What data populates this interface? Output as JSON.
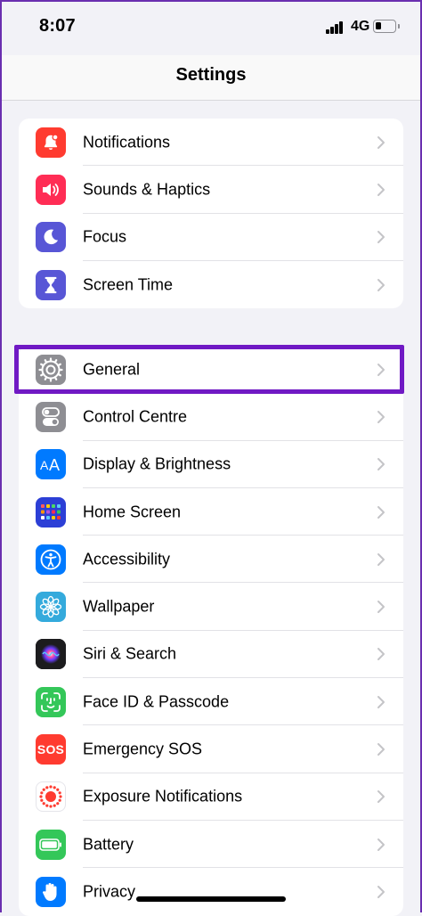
{
  "status_bar": {
    "time": "8:07",
    "network": "4G",
    "battery_level": 0.3
  },
  "nav": {
    "title": "Settings"
  },
  "groups": [
    {
      "items": [
        {
          "label": "Notifications",
          "icon": "bell-icon",
          "color": "#ff3b30"
        },
        {
          "label": "Sounds & Haptics",
          "icon": "speaker-icon",
          "color": "#ff2d55"
        },
        {
          "label": "Focus",
          "icon": "moon-icon",
          "color": "#5856d6"
        },
        {
          "label": "Screen Time",
          "icon": "hourglass-icon",
          "color": "#5856d6"
        }
      ]
    },
    {
      "items": [
        {
          "label": "General",
          "icon": "gear-icon",
          "color": "#8e8e93",
          "highlighted": true
        },
        {
          "label": "Control Centre",
          "icon": "toggle-icon",
          "color": "#8e8e93"
        },
        {
          "label": "Display & Brightness",
          "icon": "text-size-icon",
          "color": "#007aff"
        },
        {
          "label": "Home Screen",
          "icon": "app-grid-icon",
          "color": "#2c3fd6"
        },
        {
          "label": "Accessibility",
          "icon": "accessibility-icon",
          "color": "#007aff"
        },
        {
          "label": "Wallpaper",
          "icon": "flower-icon",
          "color": "#34aadc"
        },
        {
          "label": "Siri & Search",
          "icon": "siri-icon",
          "color": "#1c1c1e"
        },
        {
          "label": "Face ID & Passcode",
          "icon": "face-id-icon",
          "color": "#34c759"
        },
        {
          "label": "Emergency SOS",
          "icon": "sos-icon",
          "color": "#ff3b30",
          "icon_text": "SOS"
        },
        {
          "label": "Exposure Notifications",
          "icon": "exposure-icon",
          "color": "#ffffff"
        },
        {
          "label": "Battery",
          "icon": "battery-icon",
          "color": "#34c759"
        },
        {
          "label": "Privacy",
          "icon": "hand-icon",
          "color": "#007aff"
        }
      ]
    }
  ]
}
